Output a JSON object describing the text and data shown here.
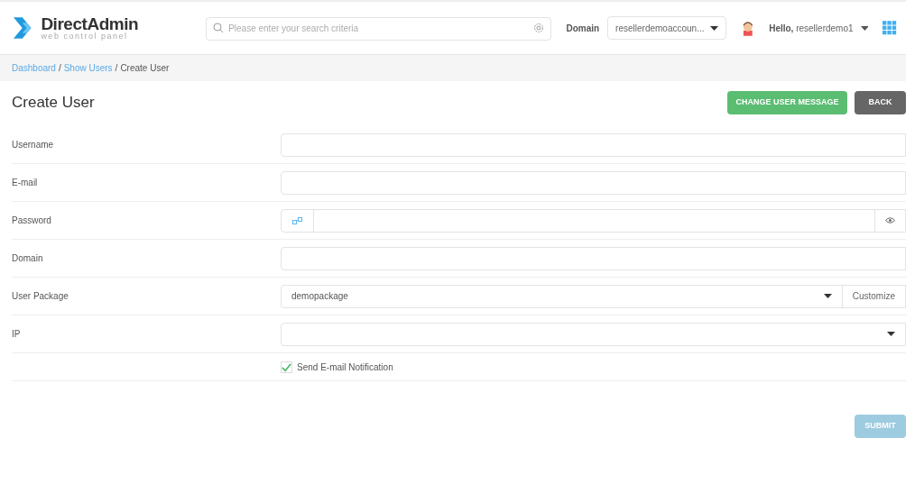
{
  "header": {
    "logo_title": "DirectAdmin",
    "logo_subtitle": "web control panel",
    "search": {
      "placeholder": "Please enter your search criteria"
    },
    "domain_label": "Domain",
    "domain_value": "resellerdemoaccoun...",
    "greeting": "Hello,",
    "username": "resellerdemo1"
  },
  "breadcrumb_separator": "/",
  "breadcrumbs": [
    {
      "label": "Dashboard",
      "kind": "link"
    },
    {
      "label": "Show Users",
      "kind": "link"
    },
    {
      "label": "Create User",
      "kind": "current"
    }
  ],
  "page_title": "Create User",
  "actions": [
    {
      "label": "CHANGE USER MESSAGE",
      "kind": "primary"
    },
    {
      "label": "BACK",
      "kind": "secondary"
    }
  ],
  "fields": [
    {
      "label": "Username",
      "kind": "text"
    },
    {
      "label": "E-mail",
      "kind": "text"
    },
    {
      "label": "Password",
      "kind": "password"
    },
    {
      "label": "Domain",
      "kind": "text"
    },
    {
      "label": "User Package",
      "kind": "select",
      "value": "demopackage",
      "addon": "Customize"
    },
    {
      "label": "IP",
      "kind": "select"
    }
  ],
  "notification": {
    "label": "Send E-mail Notification",
    "checked": true
  },
  "submit": {
    "label": "SUBMIT",
    "disabled": true
  }
}
